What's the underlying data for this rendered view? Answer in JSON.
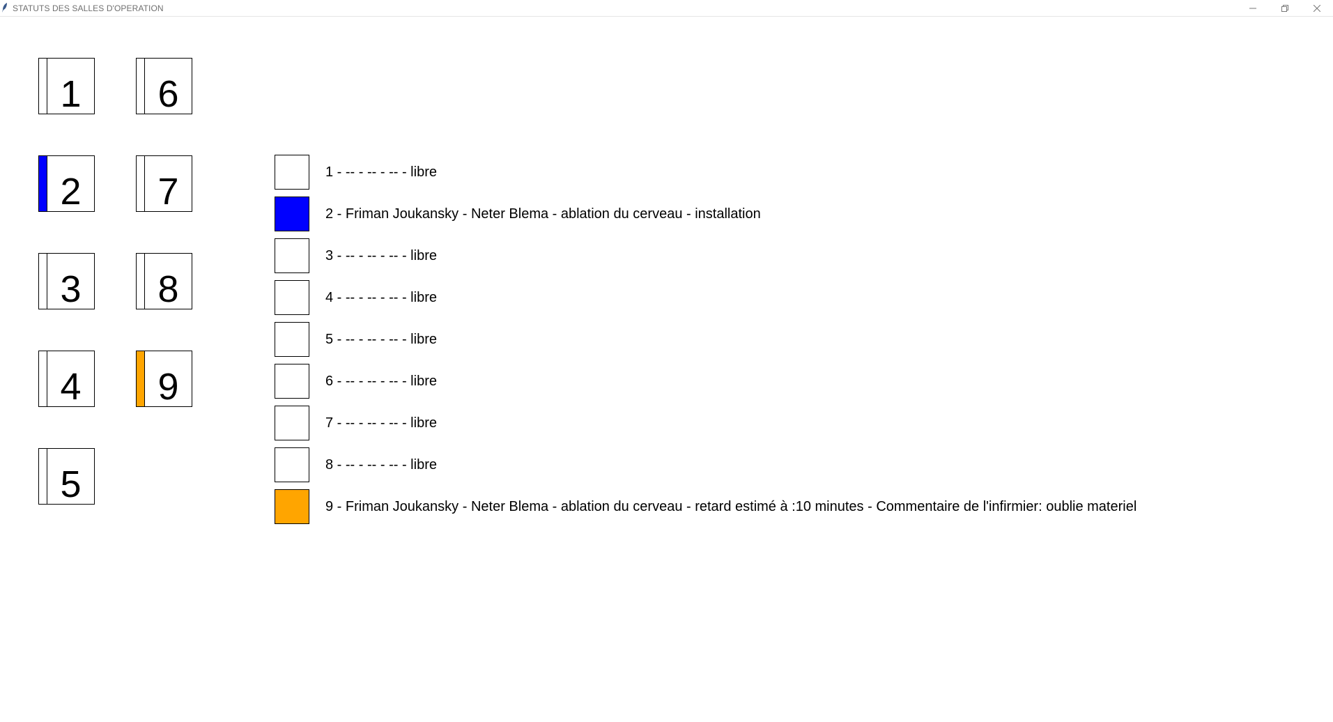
{
  "window": {
    "title": "STATUTS DES SALLES D'OPERATION",
    "controls": {
      "minimize_icon": "minimize-icon",
      "maximize_icon": "restore-icon",
      "close_icon": "close-icon"
    }
  },
  "colors": {
    "libre": "#ffffff",
    "installation": "#0000ff",
    "retard": "#ffa500",
    "border": "#000000"
  },
  "rooms": [
    {
      "number": "1",
      "status_color": "#ffffff"
    },
    {
      "number": "2",
      "status_color": "#0000ff"
    },
    {
      "number": "3",
      "status_color": "#ffffff"
    },
    {
      "number": "4",
      "status_color": "#ffffff"
    },
    {
      "number": "5",
      "status_color": "#ffffff"
    },
    {
      "number": "6",
      "status_color": "#ffffff"
    },
    {
      "number": "7",
      "status_color": "#ffffff"
    },
    {
      "number": "8",
      "status_color": "#ffffff"
    },
    {
      "number": "9",
      "status_color": "#ffa500"
    }
  ],
  "status_list": [
    {
      "color": "#ffffff",
      "text": "1 - -- - -- - -- - libre"
    },
    {
      "color": "#0000ff",
      "text": "2 - Friman Joukansky - Neter Blema - ablation du cerveau - installation"
    },
    {
      "color": "#ffffff",
      "text": "3 - -- - -- - -- - libre"
    },
    {
      "color": "#ffffff",
      "text": "4 - -- - -- - -- - libre"
    },
    {
      "color": "#ffffff",
      "text": "5 - -- - -- - -- - libre"
    },
    {
      "color": "#ffffff",
      "text": "6 - -- - -- - -- - libre"
    },
    {
      "color": "#ffffff",
      "text": "7 - -- - -- - -- - libre"
    },
    {
      "color": "#ffffff",
      "text": "8 - -- - -- - -- - libre"
    },
    {
      "color": "#ffa500",
      "text": "9 - Friman Joukansky - Neter Blema - ablation du cerveau - retard estimé à :10 minutes - Commentaire de l'infirmier: oublie materiel"
    }
  ]
}
